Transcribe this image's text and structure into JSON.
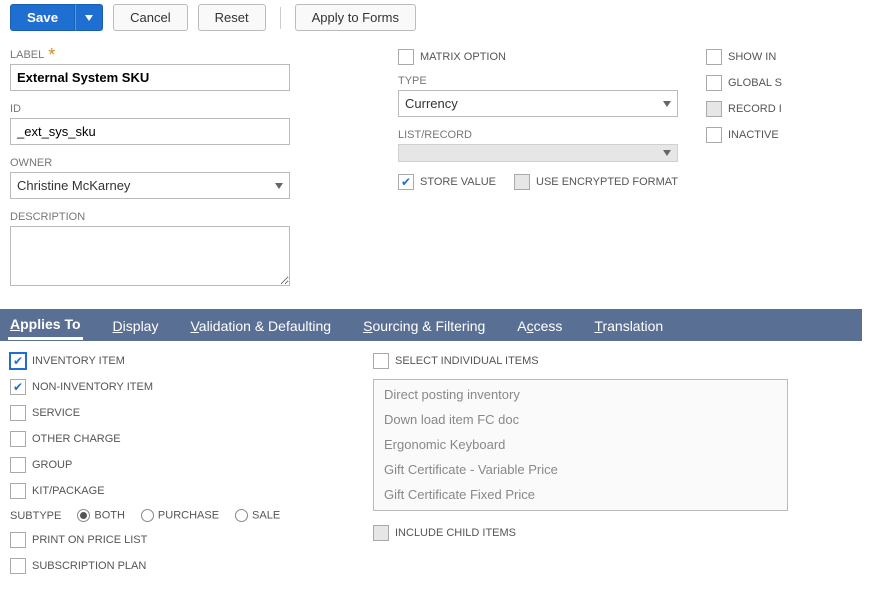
{
  "toolbar": {
    "save": "Save",
    "cancel": "Cancel",
    "reset": "Reset",
    "apply": "Apply to Forms"
  },
  "fields": {
    "label_label": "LABEL",
    "label_value": "External System SKU",
    "id_label": "ID",
    "id_value": "_ext_sys_sku",
    "owner_label": "OWNER",
    "owner_value": "Christine McKarney",
    "description_label": "DESCRIPTION",
    "type_label": "TYPE",
    "type_value": "Currency",
    "listrecord_label": "LIST/RECORD"
  },
  "flags": {
    "matrix_option": "MATRIX OPTION",
    "store_value": "STORE VALUE",
    "use_encrypted": "USE ENCRYPTED FORMAT",
    "show_in": "SHOW IN",
    "global_s": "GLOBAL S",
    "record_i": "RECORD I",
    "inactive": "INACTIVE"
  },
  "tabs": {
    "applies_to": "Applies To",
    "display": "Display",
    "validation": "Validation & Defaulting",
    "sourcing": "Sourcing & Filtering",
    "access": "Access",
    "translation": "Translation"
  },
  "applies": {
    "inventory": "INVENTORY ITEM",
    "noninventory": "NON-INVENTORY ITEM",
    "service": "SERVICE",
    "other_charge": "OTHER CHARGE",
    "group": "GROUP",
    "kit": "KIT/PACKAGE",
    "subtype": "SUBTYPE",
    "both": "BOTH",
    "purchase": "PURCHASE",
    "sale": "SALE",
    "print_price": "PRINT ON PRICE LIST",
    "subscription": "SUBSCRIPTION PLAN",
    "select_individual": "SELECT INDIVIDUAL ITEMS",
    "include_child": "INCLUDE CHILD ITEMS"
  },
  "items": [
    "Direct posting inventory",
    "Down load item FC doc",
    "Ergonomic Keyboard",
    "Gift Certificate - Variable Price",
    "Gift Certificate Fixed Price"
  ]
}
